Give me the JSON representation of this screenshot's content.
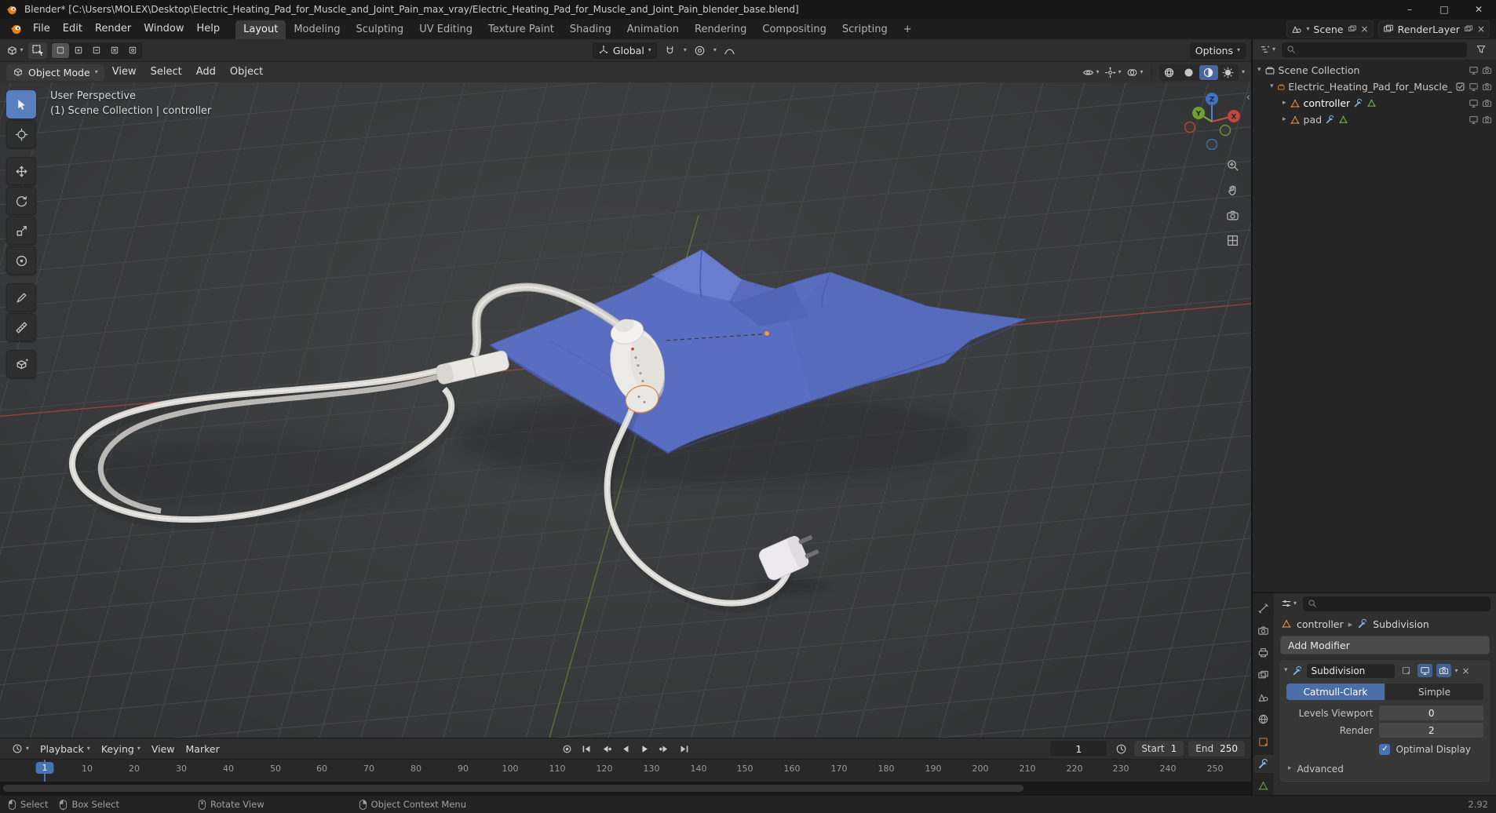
{
  "title_bar": {
    "title": "Blender* [C:\\Users\\MOLEX\\Desktop\\Electric_Heating_Pad_for_Muscle_and_Joint_Pain_max_vray/Electric_Heating_Pad_for_Muscle_and_Joint_Pain_blender_base.blend]"
  },
  "menu_bar": {
    "menus": [
      "File",
      "Edit",
      "Render",
      "Window",
      "Help"
    ],
    "workspaces": [
      "Layout",
      "Modeling",
      "Sculpting",
      "UV Editing",
      "Texture Paint",
      "Shading",
      "Animation",
      "Rendering",
      "Compositing",
      "Scripting"
    ],
    "active_workspace": "Layout",
    "add_workspace": "+",
    "scene": "Scene",
    "view_layer": "RenderLayer"
  },
  "tool_settings": {
    "orientation": "Global",
    "options": "Options"
  },
  "viewport": {
    "header": {
      "mode": "Object Mode",
      "menus": [
        "View",
        "Select",
        "Add",
        "Object"
      ]
    },
    "overlay": {
      "view_label": "User Perspective",
      "context_label": "(1) Scene Collection | controller"
    },
    "gizmo": {
      "x": "X",
      "y": "Y",
      "z": "Z"
    }
  },
  "outliner": {
    "search_placeholder": "",
    "rows": [
      {
        "label": "Scene Collection"
      },
      {
        "label": "Electric_Heating_Pad_for_Muscle_and_Joint_"
      },
      {
        "label": "controller"
      },
      {
        "label": "pad"
      }
    ]
  },
  "properties": {
    "search_placeholder": "",
    "breadcrumb": {
      "object": "controller",
      "modifier": "Subdivision"
    },
    "add_modifier": "Add Modifier",
    "modifier": {
      "name": "Subdivision",
      "algorithms": [
        "Catmull-Clark",
        "Simple"
      ],
      "active_algorithm": "Catmull-Clark",
      "rows": [
        {
          "label": "Levels Viewport",
          "value": "0"
        },
        {
          "label": "Render",
          "value": "2"
        }
      ],
      "optimal_display": "Optimal Display",
      "optimal_display_checked": true,
      "advanced": "Advanced"
    }
  },
  "timeline": {
    "menus": [
      "Playback",
      "Keying",
      "View",
      "Marker"
    ],
    "current_frame": "1",
    "start_label": "Start",
    "start": "1",
    "end_label": "End",
    "end": "250",
    "ticks": [
      "10",
      "20",
      "30",
      "40",
      "50",
      "60",
      "70",
      "80",
      "90",
      "100",
      "110",
      "120",
      "130",
      "140",
      "150",
      "160",
      "170",
      "180",
      "190",
      "200",
      "210",
      "220",
      "230",
      "240",
      "250"
    ]
  },
  "status_bar": {
    "hints": [
      "Select",
      "Box Select",
      "Rotate View",
      "Object Context Menu"
    ],
    "version": "2.92"
  }
}
